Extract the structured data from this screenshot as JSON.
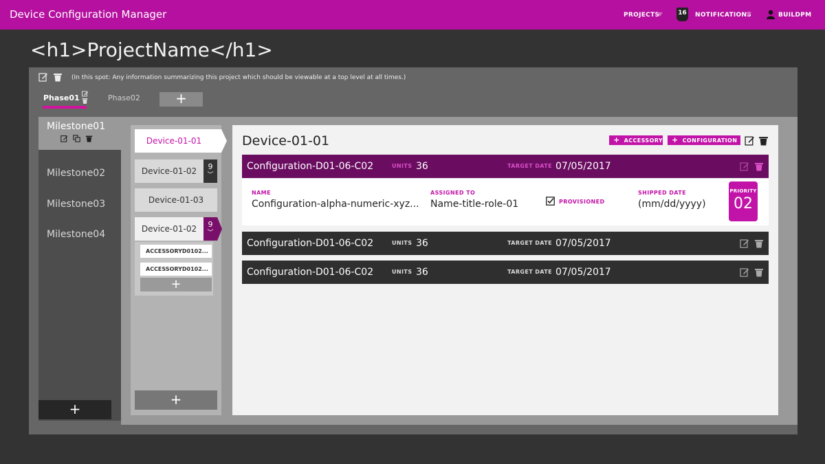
{
  "app": {
    "title": "Device Configuration Manager",
    "nav": {
      "projects": "PROJECTS",
      "notifications_count": "16",
      "notifications": "NOTIFICATIONS",
      "user": "BUILDPM"
    }
  },
  "page": {
    "title": "<h1>ProjectName</h1>",
    "summary": "(In this spot: Any information summarizing this project which should be viewable at a top level at all times.)"
  },
  "phases": {
    "tabs": [
      "Phase01",
      "Phase02"
    ],
    "add_label": "+"
  },
  "milestones": {
    "items": [
      "Milestone01",
      "Milestone02",
      "Milestone03",
      "Milestone04"
    ],
    "add_label": "+"
  },
  "devices": {
    "tabs": [
      {
        "label": "Device-01-01",
        "count": ""
      },
      {
        "label": "Device-01-02",
        "count": "9"
      },
      {
        "label": "Device-01-03",
        "count": ""
      },
      {
        "label": "Device-01-02",
        "count": "9"
      }
    ],
    "accessories": [
      "ACCESSORYD0102...",
      "ACCESSORYD0102..."
    ],
    "add_accessory_label": "+",
    "add_label": "+"
  },
  "detail": {
    "title": "Device-01-01",
    "buttons": {
      "accessory": "ACCESSORY",
      "configuration": "CONFIGURATION"
    },
    "configurations": [
      {
        "name": "Configuration-D01-06-C02",
        "units_label": "UNITS",
        "units": "36",
        "date_label": "TARGET DATE",
        "date": "07/05/2017"
      },
      {
        "name": "Configuration-D01-06-C02",
        "units_label": "UNITS",
        "units": "36",
        "date_label": "TARGET DATE",
        "date": "07/05/2017"
      },
      {
        "name": "Configuration-D01-06-C02",
        "units_label": "UNITS",
        "units": "36",
        "date_label": "TARGET DATE",
        "date": "07/05/2017"
      }
    ],
    "expanded": {
      "name_label": "NAME",
      "name": "Configuration-alpha-numeric-xyz...",
      "assigned_label": "ASSIGNED TO",
      "assigned": "Name-title-role-01",
      "provisioned_label": "PROVISIONED",
      "provisioned": true,
      "shipped_label": "SHIPPED DATE",
      "shipped": "(mm/dd/yyyy)",
      "priority_label": "PRIORITY",
      "priority": "02"
    }
  },
  "colors": {
    "accent": "#b5109f",
    "accent_dark": "#6a0d60",
    "background": "#333333",
    "panel": "#666666"
  }
}
